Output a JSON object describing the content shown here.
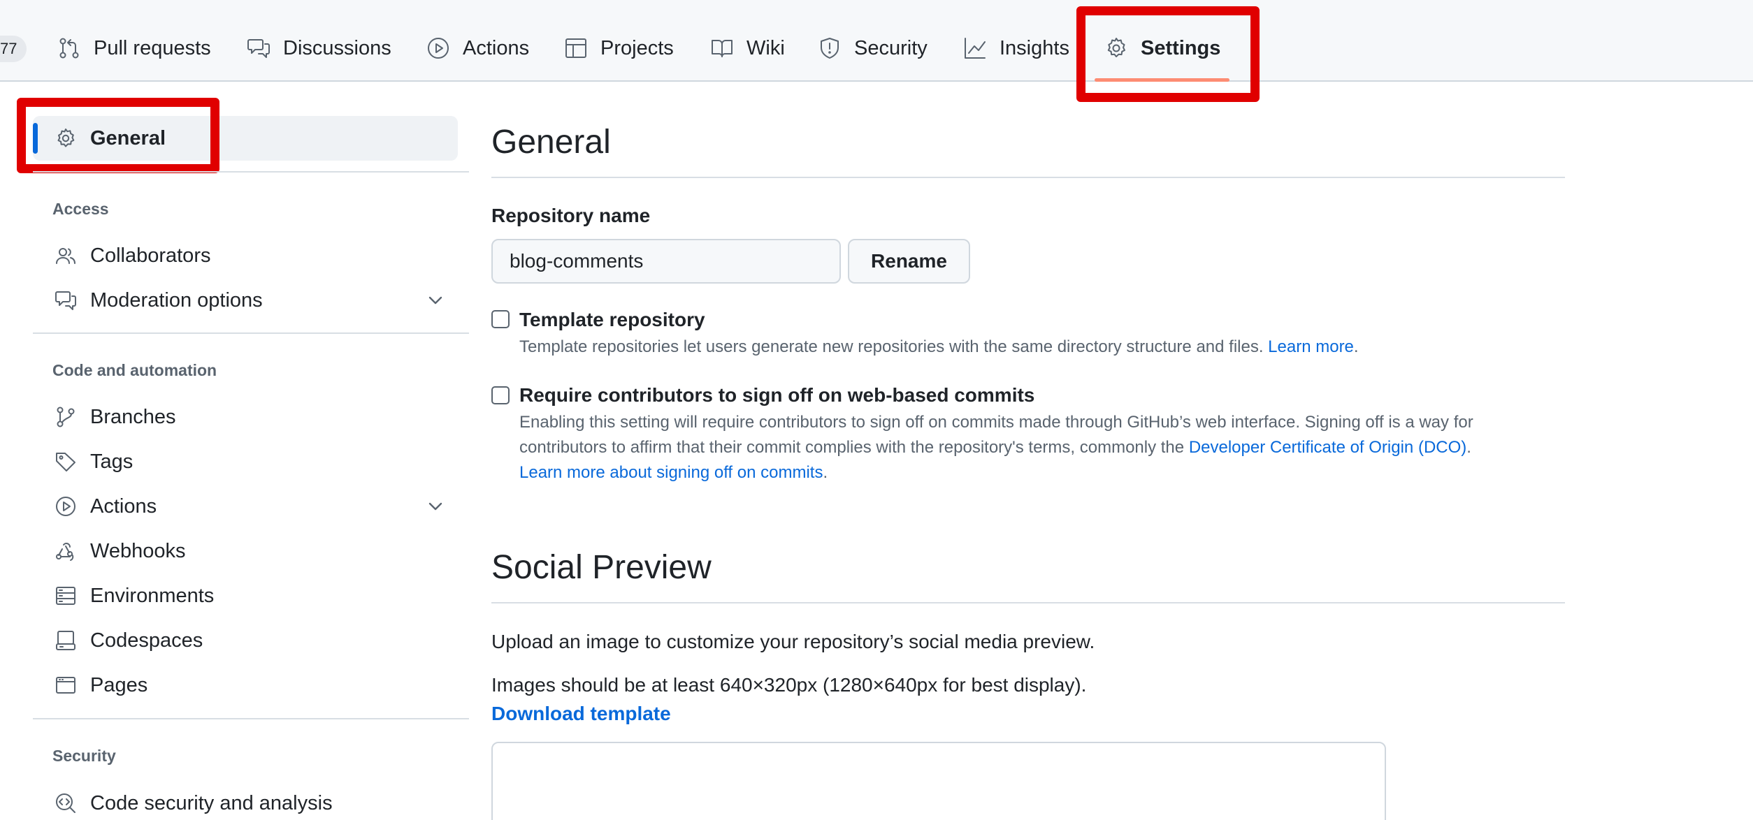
{
  "topnav": {
    "count_fragment": "77",
    "tabs": [
      {
        "label": "Pull requests",
        "icon": "pull-request-icon"
      },
      {
        "label": "Discussions",
        "icon": "discussions-icon"
      },
      {
        "label": "Actions",
        "icon": "play-icon"
      },
      {
        "label": "Projects",
        "icon": "table-icon"
      },
      {
        "label": "Wiki",
        "icon": "book-icon"
      },
      {
        "label": "Security",
        "icon": "shield-icon"
      },
      {
        "label": "Insights",
        "icon": "graph-icon"
      },
      {
        "label": "Settings",
        "icon": "gear-icon",
        "active": true
      }
    ]
  },
  "sidebar": {
    "general": {
      "label": "General",
      "icon": "gear-icon",
      "active": true
    },
    "sections": [
      {
        "heading": "Access",
        "items": [
          {
            "label": "Collaborators",
            "icon": "people-icon"
          },
          {
            "label": "Moderation options",
            "icon": "comment-discussion-icon",
            "expandable": true
          }
        ]
      },
      {
        "heading": "Code and automation",
        "items": [
          {
            "label": "Branches",
            "icon": "git-branch-icon"
          },
          {
            "label": "Tags",
            "icon": "tag-icon"
          },
          {
            "label": "Actions",
            "icon": "play-icon",
            "expandable": true
          },
          {
            "label": "Webhooks",
            "icon": "webhook-icon"
          },
          {
            "label": "Environments",
            "icon": "server-icon"
          },
          {
            "label": "Codespaces",
            "icon": "codespaces-icon"
          },
          {
            "label": "Pages",
            "icon": "browser-icon"
          }
        ]
      },
      {
        "heading": "Security",
        "items": [
          {
            "label": "Code security and analysis",
            "icon": "codescan-icon"
          }
        ]
      }
    ]
  },
  "main": {
    "title": "General",
    "repo_name_label": "Repository name",
    "repo_name_value": "blog-comments",
    "rename_label": "Rename",
    "template": {
      "title": "Template repository",
      "desc": "Template repositories let users generate new repositories with the same directory structure and files.",
      "link": "Learn more",
      "checked": false
    },
    "signoff": {
      "title": "Require contributors to sign off on web-based commits",
      "desc_1": "Enabling this setting will require contributors to sign off on commits made through GitHub’s web interface. Signing off is a way for contributors to affirm that their commit complies with the repository's terms, commonly the",
      "link_1": "Developer Certificate of Origin (DCO)",
      "link_2": "Learn more about signing off on commits",
      "checked": false
    },
    "social": {
      "title": "Social Preview",
      "line1": "Upload an image to customize your repository’s social media preview.",
      "line2": "Images should be at least 640×320px (1280×640px for best display).",
      "download": "Download template"
    }
  },
  "colors": {
    "accent": "#0969da",
    "highlight_box": "#e00000",
    "tab_underline": "#fd8c73"
  }
}
